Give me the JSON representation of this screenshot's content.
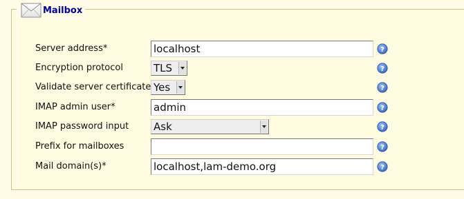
{
  "section": {
    "title": "Mailbox",
    "icon": "envelope-icon"
  },
  "fields": [
    {
      "label": "Server address*",
      "type": "text",
      "value": "localhost"
    },
    {
      "label": "Encryption protocol",
      "type": "select",
      "value": "TLS"
    },
    {
      "label": "Validate server certificate",
      "type": "select",
      "value": "Yes"
    },
    {
      "label": "IMAP admin user*",
      "type": "text",
      "value": "admin"
    },
    {
      "label": "IMAP password input",
      "type": "select",
      "value": "Ask"
    },
    {
      "label": "Prefix for mailboxes",
      "type": "text",
      "value": ""
    },
    {
      "label": "Mail domain(s)*",
      "type": "text",
      "value": "localhost,lam-demo.org"
    }
  ],
  "help_icon": "help-question-icon",
  "colors": {
    "background": "#fffbe7",
    "panel": "#fffbe0",
    "title": "#0000a8",
    "help": "#3d78d6"
  }
}
